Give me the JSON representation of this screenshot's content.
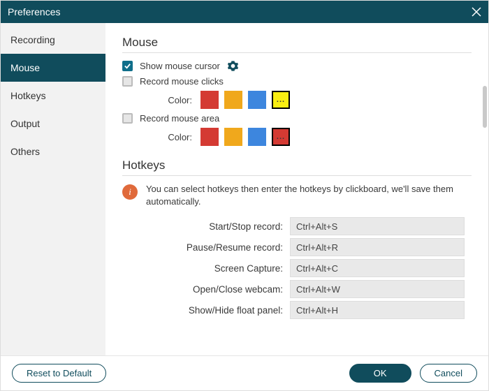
{
  "window": {
    "title": "Preferences"
  },
  "sidebar": {
    "items": [
      {
        "label": "Recording"
      },
      {
        "label": "Mouse"
      },
      {
        "label": "Hotkeys"
      },
      {
        "label": "Output"
      },
      {
        "label": "Others"
      }
    ],
    "active_index": 1
  },
  "mouse_section": {
    "heading": "Mouse",
    "show_cursor_label": "Show mouse cursor",
    "record_clicks_label": "Record mouse clicks",
    "record_area_label": "Record mouse area",
    "color_label": "Color:",
    "clicks_colors": {
      "c0": "#d43a33",
      "c1": "#f0a81c",
      "c2": "#3d86de",
      "more_bg": "#f9ee12"
    },
    "area_colors": {
      "c0": "#d43a33",
      "c1": "#f0a81c",
      "c2": "#3d86de",
      "more_bg": "#d43a33"
    },
    "more_dots": "..."
  },
  "hotkeys_section": {
    "heading": "Hotkeys",
    "info_text": "You can select hotkeys then enter the hotkeys by clickboard, we'll save them automatically.",
    "rows": [
      {
        "label": "Start/Stop record:",
        "value": "Ctrl+Alt+S"
      },
      {
        "label": "Pause/Resume record:",
        "value": "Ctrl+Alt+R"
      },
      {
        "label": "Screen Capture:",
        "value": "Ctrl+Alt+C"
      },
      {
        "label": "Open/Close webcam:",
        "value": "Ctrl+Alt+W"
      },
      {
        "label": "Show/Hide float panel:",
        "value": "Ctrl+Alt+H"
      }
    ]
  },
  "footer": {
    "reset": "Reset to Default",
    "ok": "OK",
    "cancel": "Cancel"
  }
}
